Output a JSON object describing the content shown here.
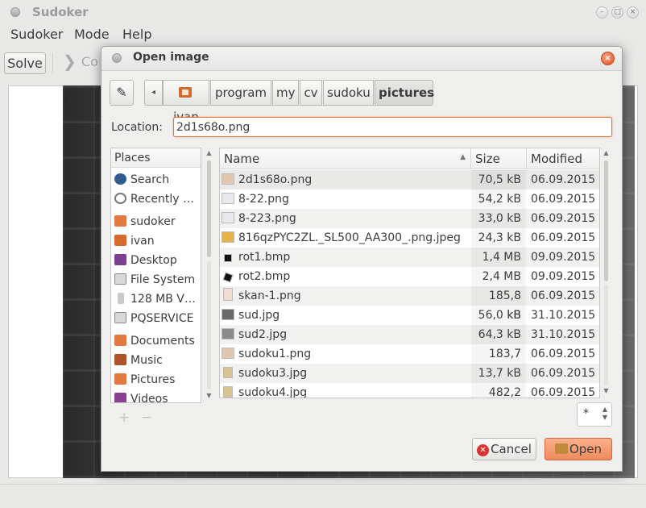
{
  "window": {
    "title": "Sudoker",
    "controls": {
      "minimize": "–",
      "maximize": "□",
      "close": "×"
    }
  },
  "menu": {
    "items": [
      "Sudoker",
      "Mode",
      "Help"
    ]
  },
  "toolbar": {
    "solve_label": "Solve",
    "next_arrow": "❯",
    "next_label_partial": "Co"
  },
  "dialog": {
    "title": "Open image",
    "close_glyph": "×",
    "edit_glyph": "✎",
    "back_glyph": "◂",
    "path": [
      "ivan",
      "program",
      "my",
      "cv",
      "sudoku",
      "pictures"
    ],
    "location_label": "Location:",
    "location_value": "2d1s68o.png",
    "places": {
      "header": "Places",
      "items": [
        {
          "label": "Search",
          "icon": "search-icon",
          "color": "#2f5b8f"
        },
        {
          "label": "Recently …",
          "icon": "clock-icon",
          "color": "#777777"
        },
        {
          "label": "sudoker",
          "icon": "folder-icon",
          "color": "#e07a3f"
        },
        {
          "label": "ivan",
          "icon": "home-folder-icon",
          "color": "#d56a2f"
        },
        {
          "label": "Desktop",
          "icon": "desktop-icon",
          "color": "#7a3f8f"
        },
        {
          "label": "File System",
          "icon": "harddisk-icon",
          "color": "#8a8a8a"
        },
        {
          "label": "128 MB V…",
          "icon": "usb-drive-icon",
          "color": "#9a9a9a"
        },
        {
          "label": "PQSERVICE",
          "icon": "drive-icon",
          "color": "#8a8a8a"
        },
        {
          "label": "Documents",
          "icon": "documents-folder-icon",
          "color": "#e07a3f"
        },
        {
          "label": "Music",
          "icon": "music-folder-icon",
          "color": "#b0522a"
        },
        {
          "label": "Pictures",
          "icon": "pictures-folder-icon",
          "color": "#e07a3f"
        },
        {
          "label": "Videos",
          "icon": "videos-folder-icon",
          "color": "#8a3f8f"
        }
      ],
      "add_glyph": "+",
      "remove_glyph": "−"
    },
    "columns": {
      "name": "Name",
      "size": "Size",
      "modified": "Modified",
      "sort_glyph": "▲"
    },
    "files": [
      {
        "name": "2d1s68o.png",
        "size": "70,5 kB",
        "modified": "06.09.2015",
        "icon": "image-thumb-icon",
        "thumb": "#e2c7b0"
      },
      {
        "name": "8-22.png",
        "size": "54,2 kB",
        "modified": "06.09.2015",
        "icon": "image-thumb-icon",
        "thumb": "#e8e8ef"
      },
      {
        "name": "8-223.png",
        "size": "33,0 kB",
        "modified": "06.09.2015",
        "icon": "image-thumb-icon",
        "thumb": "#e8e8ef"
      },
      {
        "name": "816qzPYC2ZL._SL500_AA300_.png.jpeg",
        "size": "24,3 kB",
        "modified": "06.09.2015",
        "icon": "image-thumb-icon",
        "thumb": "#e6b24a"
      },
      {
        "name": "rot1.bmp",
        "size": "1,4 MB",
        "modified": "09.09.2015",
        "icon": "image-thumb-icon",
        "thumb": "#111111"
      },
      {
        "name": "rot2.bmp",
        "size": "2,4 MB",
        "modified": "09.09.2015",
        "icon": "image-thumb-icon",
        "thumb": "#111111"
      },
      {
        "name": "skan-1.png",
        "size": "185,8 kB",
        "modified": "06.09.2015",
        "icon": "image-thumb-icon",
        "thumb": "#f0dcd2"
      },
      {
        "name": "sud.jpg",
        "size": "56,0 kB",
        "modified": "31.10.2015",
        "icon": "image-thumb-icon",
        "thumb": "#6a6a6a"
      },
      {
        "name": "sud2.jpg",
        "size": "64,3 kB",
        "modified": "31.10.2015",
        "icon": "image-thumb-icon",
        "thumb": "#8a8a8a"
      },
      {
        "name": "sudoku1.png",
        "size": "183,7 kB",
        "modified": "06.09.2015",
        "icon": "image-thumb-icon",
        "thumb": "#e2c7b0"
      },
      {
        "name": "sudoku3.jpg",
        "size": "13,7 kB",
        "modified": "06.09.2015",
        "icon": "image-thumb-icon",
        "thumb": "#d9c48f"
      },
      {
        "name": "sudoku4.jpg",
        "size": "482,2 kB",
        "modified": "06.09.2015",
        "icon": "image-thumb-icon",
        "thumb": "#d9c48f"
      }
    ],
    "filter_value": "*",
    "cancel_label": "Cancel",
    "open_label": "Open"
  },
  "colors": {
    "accent": "#e0743c",
    "open_button": "#f08a5d",
    "cancel_icon": "#d8332f"
  }
}
